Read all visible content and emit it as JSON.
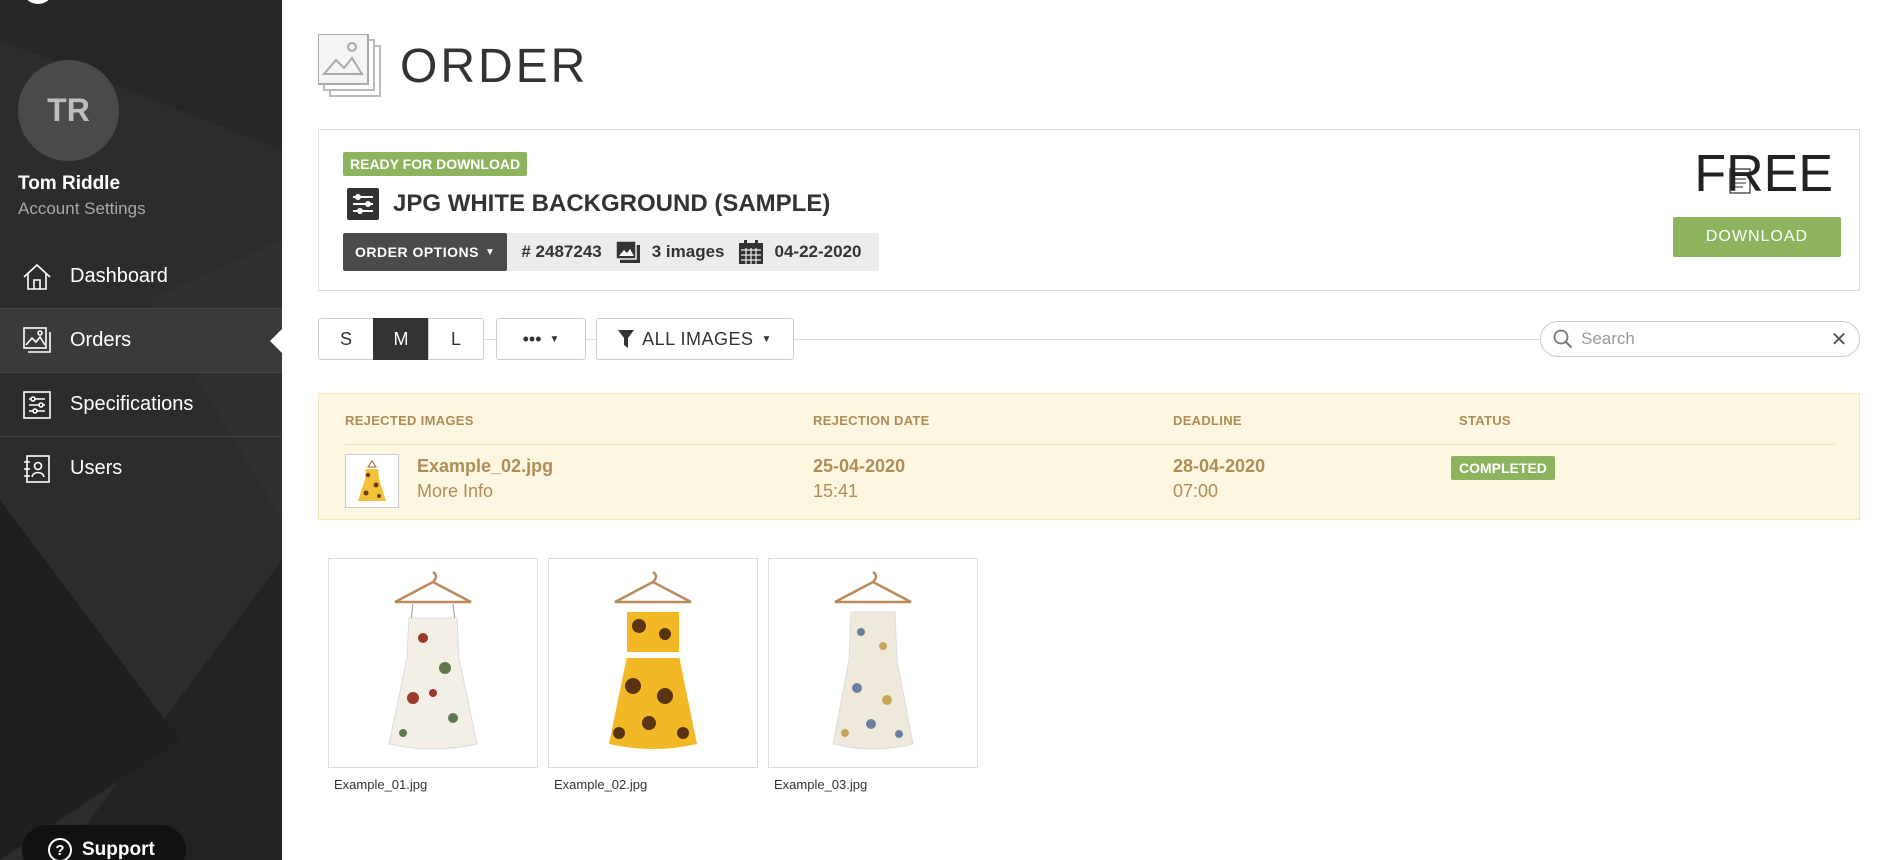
{
  "sidebar": {
    "avatar_initials": "TR",
    "user_name": "Tom Riddle",
    "account_settings": "Account Settings",
    "nav": [
      {
        "label": "Dashboard",
        "icon": "home-icon"
      },
      {
        "label": "Orders",
        "icon": "images-icon",
        "active": true
      },
      {
        "label": "Specifications",
        "icon": "sliders-icon"
      },
      {
        "label": "Users",
        "icon": "address-book-icon"
      }
    ],
    "support_label": "Support"
  },
  "page": {
    "title": "ORDER"
  },
  "order": {
    "status": "READY FOR DOWNLOAD",
    "name": "JPG WHITE BACKGROUND (SAMPLE)",
    "options_label": "ORDER OPTIONS",
    "number": "# 2487243",
    "image_count": "3 images",
    "date": "04-22-2020",
    "price": "FREE",
    "download_label": "DOWNLOAD"
  },
  "toolbar": {
    "sizes": [
      "S",
      "M",
      "L"
    ],
    "active_size": "M",
    "more_label": "•••",
    "filter_label": "ALL IMAGES",
    "search_placeholder": "Search"
  },
  "rejected": {
    "headers": {
      "images": "REJECTED IMAGES",
      "rejection_date": "REJECTION DATE",
      "deadline": "DEADLINE",
      "status": "STATUS"
    },
    "row": {
      "file": "Example_02.jpg",
      "more_info": "More Info",
      "rejection_date": "25-04-2020",
      "rejection_time": "15:41",
      "deadline_date": "28-04-2020",
      "deadline_time": "07:00",
      "status": "COMPLETED"
    }
  },
  "gallery": [
    {
      "name": "Example_01.jpg"
    },
    {
      "name": "Example_02.jpg"
    },
    {
      "name": "Example_03.jpg"
    }
  ],
  "colors": {
    "sidebar_bg": "#262626",
    "accent_green": "#8db35f",
    "rejected_bg": "#fdf6e0",
    "rejected_text": "#b08d57"
  }
}
